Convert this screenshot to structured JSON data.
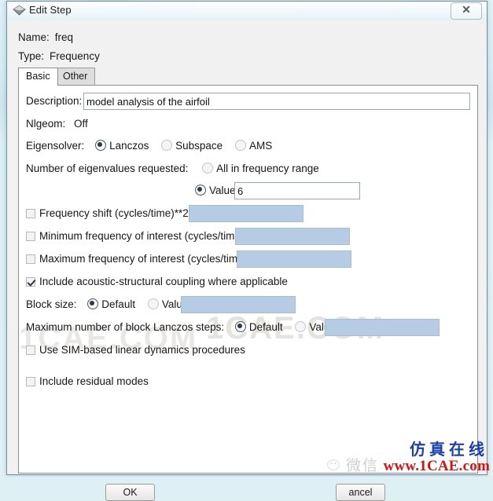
{
  "window": {
    "title": "Edit Step",
    "icon": "abaqus-diamond-icon",
    "close_label": "✕"
  },
  "header": {
    "name_label": "Name:",
    "name_value": "freq",
    "type_label": "Type:",
    "type_value": "Frequency"
  },
  "tabs": [
    {
      "label": "Basic",
      "active": true
    },
    {
      "label": "Other",
      "active": false
    }
  ],
  "form": {
    "description_label": "Description:",
    "description_value": "model analysis of the airfoil",
    "nlgeom_label": "Nlgeom:",
    "nlgeom_value": "Off",
    "eigensolver_label": "Eigensolver:",
    "eigensolver_options": [
      {
        "label": "Lanczos",
        "selected": true
      },
      {
        "label": "Subspace",
        "selected": false
      },
      {
        "label": "AMS",
        "selected": false
      }
    ],
    "num_eigen_label": "Number of eigenvalues requested:",
    "num_eigen_all_label": "All in frequency range",
    "num_eigen_all_selected": false,
    "num_eigen_value_label": "Value:",
    "num_eigen_value_selected": true,
    "num_eigen_value": "6",
    "freq_shift_label": "Frequency shift (cycles/time)**2:",
    "freq_shift_checked": false,
    "freq_shift_value": "",
    "min_freq_label": "Minimum frequency of interest (cycles/time):",
    "min_freq_checked": false,
    "min_freq_value": "",
    "max_freq_label": "Maximum frequency of interest (cycles/time):",
    "max_freq_checked": false,
    "max_freq_value": "",
    "acoustic_label": "Include acoustic-structural coupling where applicable",
    "acoustic_checked": true,
    "block_size_label": "Block size:",
    "block_size_default_label": "Default",
    "block_size_default_selected": true,
    "block_size_value_label": "Value:",
    "block_size_value_selected": false,
    "block_size_value": "",
    "max_lanczos_label": "Maximum number of block Lanczos steps:",
    "max_lanczos_default_label": "Default",
    "max_lanczos_default_selected": true,
    "max_lanczos_value_label": "Value:",
    "max_lanczos_value_selected": false,
    "max_lanczos_value": "",
    "sim_label": "Use SIM-based linear dynamics procedures",
    "sim_checked": false,
    "residual_label": "Include residual modes",
    "residual_checked": false
  },
  "buttons": {
    "ok": "OK",
    "cancel": "ancel"
  },
  "watermark": {
    "faint_center": "1CAE.COM",
    "faint_left": "1CAE.COM",
    "blue_text": "仿真在线",
    "red_text": "www.1CAE.com",
    "weixin_text": "微信",
    "blue_color": "#1a3fb0",
    "red_color": "#d81111"
  }
}
